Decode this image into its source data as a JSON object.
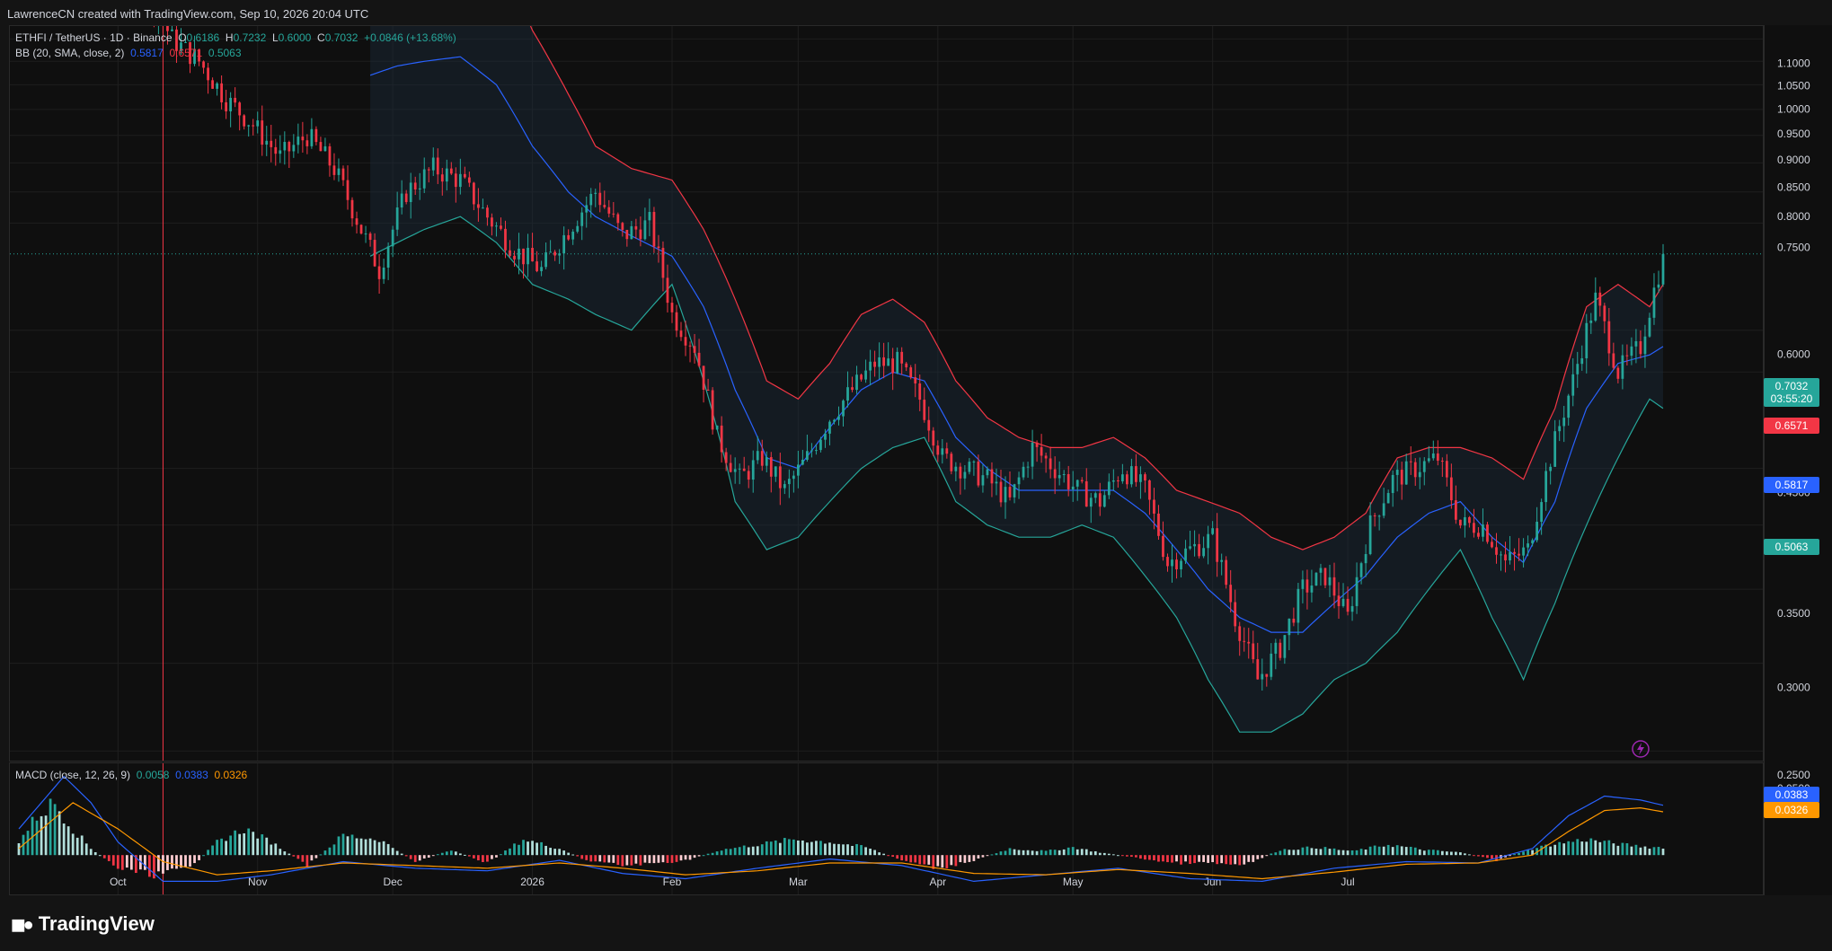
{
  "header": {
    "credit": "LawrenceCN created with TradingView.com, Sep 10, 2026 20:04 UTC"
  },
  "legend": {
    "symbol": "ETHFI / TetherUS · 1D · Binance",
    "o_label": "O",
    "o_value": "0.6186",
    "h_label": "H",
    "h_value": "0.7232",
    "l_label": "L",
    "l_value": "0.6000",
    "c_label": "C",
    "c_value": "0.7032",
    "change": "+0.0846 (+13.68%)",
    "bb_label": "BB (20, SMA, close, 2)",
    "bb_basis": "0.5817",
    "bb_upper": "0.6571",
    "bb_lower": "0.5063",
    "macd_label": "MACD (close, 12, 26, 9)",
    "macd_hist": "0.0058",
    "macd_line": "0.0383",
    "macd_signal": "0.0326"
  },
  "badges": {
    "last_price": "0.7032",
    "countdown": "03:55:20",
    "upper": "0.6571",
    "basis": "0.5817",
    "lower": "0.5063",
    "macd_line": "0.0383",
    "macd_signal": "0.0326"
  },
  "colors": {
    "up": "#26a69a",
    "down": "#f23645",
    "basis": "#2962ff",
    "signal": "#ff9800",
    "band_fill": "#1b2a3a"
  },
  "icons": {
    "alert": "lightning-bolt-icon",
    "logo": "tradingview-logo-icon"
  },
  "footer": {
    "brand": "TradingView"
  },
  "chart_data": {
    "type": "candlestick",
    "price_axis": {
      "ticks": [
        "1.1000",
        "1.0500",
        "1.0000",
        "0.9500",
        "0.9000",
        "0.8500",
        "0.8000",
        "0.7500",
        "0.6000",
        "0.5500",
        "0.4500",
        "0.4000",
        "0.3500",
        "0.3000",
        "0.2500"
      ],
      "ylim": [
        0.25,
        1.1
      ]
    },
    "macd_axis": {
      "ticks": [
        "0.0500"
      ],
      "ylim": [
        -0.03,
        0.07
      ]
    },
    "time_axis": {
      "labels": [
        "Oct",
        "Nov",
        "Dec",
        "2026",
        "Feb",
        "Mar",
        "Apr",
        "May",
        "Jun",
        "Jul"
      ],
      "label_day_index": [
        0,
        31,
        61,
        92,
        123,
        151,
        182,
        212,
        243,
        273
      ]
    },
    "day_range": [
      -22,
      343
    ],
    "last_price": 0.7032,
    "candles_note_series": "daily close (data units), index 0 = Oct 1",
    "price_keypoints": [
      [
        -22,
        1.28
      ],
      [
        -15,
        1.3
      ],
      [
        -8,
        1.45
      ],
      [
        0,
        1.35
      ],
      [
        7,
        1.2
      ],
      [
        12,
        1.1
      ],
      [
        18,
        1.05
      ],
      [
        24,
        0.97
      ],
      [
        30,
        0.92
      ],
      [
        36,
        0.86
      ],
      [
        42,
        0.9
      ],
      [
        48,
        0.84
      ],
      [
        54,
        0.74
      ],
      [
        58,
        0.68
      ],
      [
        64,
        0.8
      ],
      [
        70,
        0.84
      ],
      [
        76,
        0.82
      ],
      [
        82,
        0.76
      ],
      [
        88,
        0.71
      ],
      [
        94,
        0.68
      ],
      [
        100,
        0.74
      ],
      [
        106,
        0.8
      ],
      [
        112,
        0.73
      ],
      [
        118,
        0.75
      ],
      [
        123,
        0.62
      ],
      [
        128,
        0.58
      ],
      [
        133,
        0.48
      ],
      [
        138,
        0.44
      ],
      [
        143,
        0.46
      ],
      [
        148,
        0.43
      ],
      [
        153,
        0.46
      ],
      [
        158,
        0.5
      ],
      [
        163,
        0.53
      ],
      [
        168,
        0.56
      ],
      [
        173,
        0.56
      ],
      [
        178,
        0.52
      ],
      [
        183,
        0.46
      ],
      [
        188,
        0.45
      ],
      [
        193,
        0.44
      ],
      [
        198,
        0.42
      ],
      [
        203,
        0.47
      ],
      [
        208,
        0.45
      ],
      [
        213,
        0.43
      ],
      [
        218,
        0.42
      ],
      [
        223,
        0.45
      ],
      [
        228,
        0.43
      ],
      [
        233,
        0.37
      ],
      [
        238,
        0.38
      ],
      [
        243,
        0.39
      ],
      [
        248,
        0.33
      ],
      [
        253,
        0.29
      ],
      [
        258,
        0.31
      ],
      [
        263,
        0.35
      ],
      [
        268,
        0.36
      ],
      [
        273,
        0.33
      ],
      [
        278,
        0.4
      ],
      [
        283,
        0.44
      ],
      [
        288,
        0.45
      ],
      [
        293,
        0.46
      ],
      [
        298,
        0.4
      ],
      [
        303,
        0.4
      ],
      [
        308,
        0.37
      ],
      [
        313,
        0.38
      ],
      [
        318,
        0.46
      ],
      [
        323,
        0.54
      ],
      [
        328,
        0.64
      ],
      [
        333,
        0.55
      ],
      [
        338,
        0.58
      ],
      [
        343,
        0.7
      ]
    ],
    "bb_upper_keypoints": [
      [
        56,
        1.32
      ],
      [
        62,
        1.38
      ],
      [
        68,
        1.45
      ],
      [
        76,
        1.44
      ],
      [
        84,
        1.32
      ],
      [
        92,
        1.12
      ],
      [
        100,
        0.98
      ],
      [
        106,
        0.88
      ],
      [
        114,
        0.84
      ],
      [
        123,
        0.82
      ],
      [
        130,
        0.74
      ],
      [
        137,
        0.64
      ],
      [
        144,
        0.54
      ],
      [
        151,
        0.52
      ],
      [
        158,
        0.56
      ],
      [
        165,
        0.62
      ],
      [
        172,
        0.64
      ],
      [
        179,
        0.61
      ],
      [
        186,
        0.54
      ],
      [
        193,
        0.5
      ],
      [
        200,
        0.48
      ],
      [
        207,
        0.47
      ],
      [
        214,
        0.47
      ],
      [
        221,
        0.48
      ],
      [
        228,
        0.46
      ],
      [
        235,
        0.43
      ],
      [
        242,
        0.42
      ],
      [
        249,
        0.41
      ],
      [
        256,
        0.39
      ],
      [
        263,
        0.38
      ],
      [
        270,
        0.39
      ],
      [
        277,
        0.41
      ],
      [
        284,
        0.46
      ],
      [
        291,
        0.47
      ],
      [
        298,
        0.47
      ],
      [
        305,
        0.46
      ],
      [
        312,
        0.44
      ],
      [
        319,
        0.51
      ],
      [
        326,
        0.63
      ],
      [
        333,
        0.66
      ],
      [
        340,
        0.63
      ],
      [
        343,
        0.66
      ]
    ],
    "bb_lower_keypoints": [
      [
        56,
        0.7
      ],
      [
        62,
        0.72
      ],
      [
        68,
        0.74
      ],
      [
        76,
        0.76
      ],
      [
        84,
        0.72
      ],
      [
        92,
        0.66
      ],
      [
        100,
        0.64
      ],
      [
        106,
        0.62
      ],
      [
        114,
        0.6
      ],
      [
        123,
        0.66
      ],
      [
        130,
        0.54
      ],
      [
        137,
        0.42
      ],
      [
        144,
        0.38
      ],
      [
        151,
        0.39
      ],
      [
        158,
        0.42
      ],
      [
        165,
        0.45
      ],
      [
        172,
        0.47
      ],
      [
        179,
        0.48
      ],
      [
        186,
        0.42
      ],
      [
        193,
        0.4
      ],
      [
        200,
        0.39
      ],
      [
        207,
        0.39
      ],
      [
        214,
        0.4
      ],
      [
        221,
        0.39
      ],
      [
        228,
        0.36
      ],
      [
        235,
        0.33
      ],
      [
        242,
        0.29
      ],
      [
        249,
        0.26
      ],
      [
        256,
        0.26
      ],
      [
        263,
        0.27
      ],
      [
        270,
        0.29
      ],
      [
        277,
        0.3
      ],
      [
        284,
        0.32
      ],
      [
        291,
        0.35
      ],
      [
        298,
        0.38
      ],
      [
        305,
        0.33
      ],
      [
        312,
        0.29
      ],
      [
        319,
        0.34
      ],
      [
        326,
        0.4
      ],
      [
        333,
        0.46
      ],
      [
        340,
        0.52
      ],
      [
        343,
        0.51
      ]
    ],
    "bb_basis_keypoints": [
      [
        56,
        1.02
      ],
      [
        62,
        1.04
      ],
      [
        68,
        1.05
      ],
      [
        76,
        1.06
      ],
      [
        84,
        1.0
      ],
      [
        92,
        0.88
      ],
      [
        100,
        0.8
      ],
      [
        106,
        0.76
      ],
      [
        114,
        0.73
      ],
      [
        123,
        0.7
      ],
      [
        130,
        0.63
      ],
      [
        137,
        0.53
      ],
      [
        144,
        0.46
      ],
      [
        151,
        0.45
      ],
      [
        158,
        0.49
      ],
      [
        165,
        0.53
      ],
      [
        172,
        0.55
      ],
      [
        179,
        0.54
      ],
      [
        186,
        0.48
      ],
      [
        193,
        0.45
      ],
      [
        200,
        0.43
      ],
      [
        207,
        0.43
      ],
      [
        214,
        0.43
      ],
      [
        221,
        0.43
      ],
      [
        228,
        0.41
      ],
      [
        235,
        0.38
      ],
      [
        242,
        0.35
      ],
      [
        249,
        0.33
      ],
      [
        256,
        0.32
      ],
      [
        263,
        0.32
      ],
      [
        270,
        0.34
      ],
      [
        277,
        0.36
      ],
      [
        284,
        0.39
      ],
      [
        291,
        0.41
      ],
      [
        298,
        0.42
      ],
      [
        305,
        0.39
      ],
      [
        312,
        0.37
      ],
      [
        319,
        0.42
      ],
      [
        326,
        0.51
      ],
      [
        333,
        0.56
      ],
      [
        340,
        0.57
      ],
      [
        343,
        0.58
      ]
    ],
    "macd_hist_keypoints": [
      [
        -22,
        0.01
      ],
      [
        -18,
        0.03
      ],
      [
        -14,
        0.04
      ],
      [
        -10,
        0.02
      ],
      [
        -6,
        0.005
      ],
      [
        0,
        -0.01
      ],
      [
        8,
        -0.015
      ],
      [
        16,
        -0.01
      ],
      [
        22,
        0.01
      ],
      [
        28,
        0.02
      ],
      [
        34,
        0.01
      ],
      [
        42,
        -0.008
      ],
      [
        50,
        0.015
      ],
      [
        58,
        0.012
      ],
      [
        66,
        -0.005
      ],
      [
        74,
        0.004
      ],
      [
        82,
        -0.006
      ],
      [
        90,
        0.012
      ],
      [
        98,
        0.005
      ],
      [
        104,
        -0.004
      ],
      [
        112,
        -0.008
      ],
      [
        120,
        -0.006
      ],
      [
        126,
        -0.004
      ],
      [
        134,
        0.004
      ],
      [
        142,
        0.008
      ],
      [
        150,
        0.012
      ],
      [
        158,
        0.01
      ],
      [
        166,
        0.006
      ],
      [
        174,
        -0.004
      ],
      [
        182,
        -0.01
      ],
      [
        190,
        -0.004
      ],
      [
        198,
        0.005
      ],
      [
        206,
        0.003
      ],
      [
        212,
        0.006
      ],
      [
        218,
        0.002
      ],
      [
        226,
        -0.002
      ],
      [
        234,
        -0.006
      ],
      [
        242,
        -0.006
      ],
      [
        250,
        -0.008
      ],
      [
        258,
        0.004
      ],
      [
        266,
        0.006
      ],
      [
        274,
        0.003
      ],
      [
        282,
        0.008
      ],
      [
        290,
        0.004
      ],
      [
        298,
        0.002
      ],
      [
        306,
        -0.004
      ],
      [
        312,
        0.003
      ],
      [
        318,
        0.008
      ],
      [
        326,
        0.012
      ],
      [
        334,
        0.008
      ],
      [
        340,
        0.006
      ],
      [
        343,
        0.006
      ]
    ],
    "macd_line_keypoints": [
      [
        -22,
        0.02
      ],
      [
        -12,
        0.06
      ],
      [
        -6,
        0.04
      ],
      [
        0,
        0.01
      ],
      [
        10,
        -0.02
      ],
      [
        22,
        -0.02
      ],
      [
        34,
        -0.015
      ],
      [
        50,
        -0.005
      ],
      [
        66,
        -0.01
      ],
      [
        82,
        -0.012
      ],
      [
        98,
        -0.004
      ],
      [
        112,
        -0.014
      ],
      [
        126,
        -0.018
      ],
      [
        142,
        -0.01
      ],
      [
        158,
        -0.003
      ],
      [
        174,
        -0.008
      ],
      [
        190,
        -0.02
      ],
      [
        206,
        -0.015
      ],
      [
        222,
        -0.01
      ],
      [
        238,
        -0.018
      ],
      [
        254,
        -0.02
      ],
      [
        270,
        -0.01
      ],
      [
        286,
        -0.005
      ],
      [
        302,
        -0.006
      ],
      [
        314,
        0.005
      ],
      [
        322,
        0.03
      ],
      [
        330,
        0.045
      ],
      [
        338,
        0.042
      ],
      [
        343,
        0.038
      ]
    ],
    "macd_signal_keypoints": [
      [
        -22,
        0.005
      ],
      [
        -10,
        0.04
      ],
      [
        0,
        0.02
      ],
      [
        10,
        -0.005
      ],
      [
        22,
        -0.015
      ],
      [
        34,
        -0.012
      ],
      [
        50,
        -0.006
      ],
      [
        66,
        -0.008
      ],
      [
        82,
        -0.01
      ],
      [
        98,
        -0.006
      ],
      [
        112,
        -0.01
      ],
      [
        126,
        -0.015
      ],
      [
        142,
        -0.012
      ],
      [
        158,
        -0.006
      ],
      [
        174,
        -0.006
      ],
      [
        190,
        -0.014
      ],
      [
        206,
        -0.015
      ],
      [
        222,
        -0.011
      ],
      [
        238,
        -0.014
      ],
      [
        254,
        -0.018
      ],
      [
        270,
        -0.013
      ],
      [
        286,
        -0.007
      ],
      [
        302,
        -0.006
      ],
      [
        314,
        0.0
      ],
      [
        322,
        0.018
      ],
      [
        330,
        0.034
      ],
      [
        338,
        0.036
      ],
      [
        343,
        0.033
      ]
    ]
  }
}
